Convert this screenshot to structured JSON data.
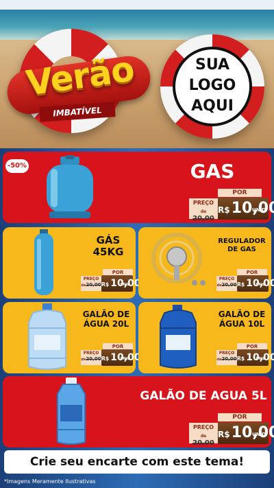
{
  "header": {
    "brand_title": "Verão",
    "brand_subtitle": "IMBATÍVEL",
    "logo_lines": [
      "SUA",
      "LOGO",
      "AQUI"
    ]
  },
  "products": [
    {
      "title": "GAS",
      "badge": "-50%",
      "por_label": "POR",
      "preco_label": "PREÇO",
      "old_prefix": "de",
      "old_price": "20,00",
      "currency": "R$",
      "price": "10,00",
      "unit": "UNID"
    },
    {
      "title": "GÁS 45KG",
      "por_label": "POR",
      "preco_label": "PREÇO",
      "old_prefix": "de",
      "old_price": "20,00",
      "currency": "R$",
      "price": "10,00",
      "unit": "UNID"
    },
    {
      "title": "REGULADOR DE GAS",
      "por_label": "POR",
      "preco_label": "PREÇO",
      "old_prefix": "de",
      "old_price": "20,00",
      "currency": "R$",
      "price": "10,00",
      "unit": "UNID"
    },
    {
      "title": "GALÃO DE ÁGUA 20L",
      "por_label": "POR",
      "preco_label": "PREÇO",
      "old_prefix": "de",
      "old_price": "20,00",
      "currency": "R$",
      "price": "10,00",
      "unit": "UNID"
    },
    {
      "title": "GALÃO DE ÁGUA 10L",
      "por_label": "POR",
      "preco_label": "PREÇO",
      "old_prefix": "de",
      "old_price": "20,00",
      "currency": "R$",
      "price": "10,00",
      "unit": "UNID"
    },
    {
      "title": "GALÃO DE AGUA 5L",
      "por_label": "POR",
      "preco_label": "PREÇO",
      "old_prefix": "de",
      "old_price": "20,00",
      "currency": "R$",
      "price": "10,00",
      "unit": "UNID"
    }
  ],
  "footer": {
    "cta": "Crie seu encarte com este tema!",
    "disclaimer": "*Imagens Meramente Ilustrativas"
  },
  "colors": {
    "red": "#d7141b",
    "yellow": "#f6b81b",
    "blue": "#2d6cb5",
    "gold": "#ffd21f"
  }
}
